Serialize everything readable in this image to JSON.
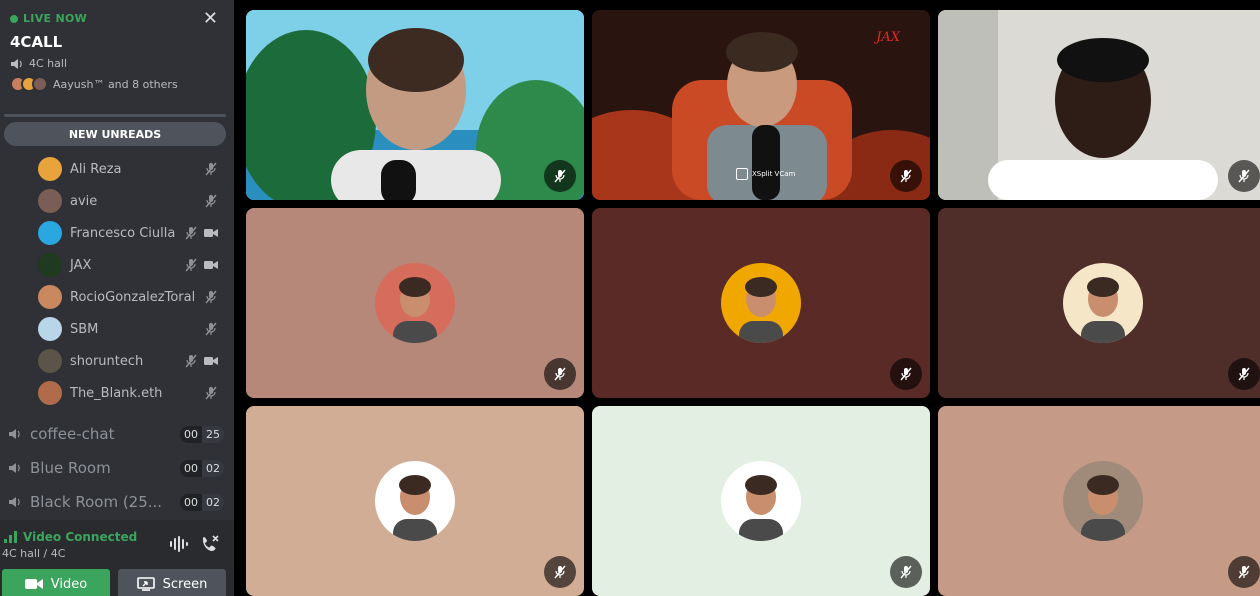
{
  "live": {
    "status": "LIVE NOW",
    "call_name": "4CALL",
    "channel": "4C hall",
    "participants_text": "Aayush™ and 8 others"
  },
  "unreads_label": "NEW UNREADS",
  "members": [
    {
      "name": "Ali Reza",
      "muted": true,
      "video": false,
      "avatar_color": "#e8a33d"
    },
    {
      "name": "avie",
      "muted": true,
      "video": false,
      "avatar_color": "#7a5e55"
    },
    {
      "name": "Francesco Ciulla",
      "muted": true,
      "video": true,
      "avatar_color": "#2aa7e0"
    },
    {
      "name": "JAX",
      "muted": true,
      "video": true,
      "avatar_color": "#1f3a1f"
    },
    {
      "name": "RocioGonzalezToral",
      "muted": true,
      "video": false,
      "avatar_color": "#c9885e"
    },
    {
      "name": "SBM",
      "muted": true,
      "video": false,
      "avatar_color": "#b8d6e8"
    },
    {
      "name": "shoruntech",
      "muted": true,
      "video": true,
      "avatar_color": "#5b5448"
    },
    {
      "name": "The_Blank.eth",
      "muted": true,
      "video": false,
      "avatar_color": "#b06b4a"
    }
  ],
  "channels": [
    {
      "name": "coffee-chat",
      "count_a": "00",
      "count_b": "25"
    },
    {
      "name": "Blue Room",
      "count_a": "00",
      "count_b": "02"
    },
    {
      "name": "Black Room (25...",
      "count_a": "00",
      "count_b": "02"
    }
  ],
  "voice": {
    "status": "Video Connected",
    "location": "4C hall / 4C",
    "video_label": "Video",
    "screen_label": "Screen"
  },
  "stream_overlay": {
    "label": "XSplit VCam",
    "signature": "JAX"
  },
  "tiles": [
    {
      "kind": "video",
      "bg": "#6fc2e0"
    },
    {
      "kind": "video",
      "bg": "#3a1a14"
    },
    {
      "kind": "video",
      "bg": "#d9d9d4"
    },
    {
      "kind": "avatar",
      "bg": "#b5887a",
      "avatar_bg": "#d66d5c"
    },
    {
      "kind": "avatar",
      "bg": "#5a2a26",
      "avatar_bg": "#f0a800"
    },
    {
      "kind": "avatar",
      "bg": "#4f2e2a",
      "avatar_bg": "#f5e6c8"
    },
    {
      "kind": "avatar",
      "bg": "#d1ad96",
      "avatar_bg": "#ffffff"
    },
    {
      "kind": "avatar",
      "bg": "#e3efe3",
      "avatar_bg": "#ffffff"
    },
    {
      "kind": "avatar",
      "bg": "#c59a86",
      "avatar_bg": "#a08a7a"
    }
  ],
  "colors": {
    "accent_green": "#3ba55d",
    "sidebar": "#2f3136",
    "panel": "#292b2f"
  },
  "icons": [
    "close-icon",
    "speaker-icon",
    "mic-muted-icon",
    "camera-icon",
    "signal-icon",
    "soundboard-icon",
    "disconnect-icon",
    "video-icon",
    "screen-share-icon"
  ]
}
